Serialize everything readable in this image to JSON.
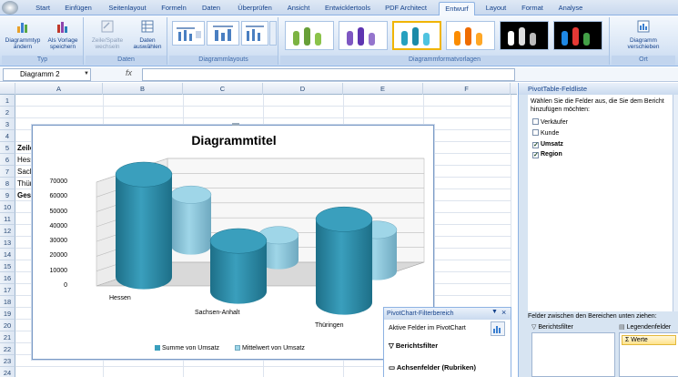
{
  "ribbon": {
    "tabs": [
      "Start",
      "Einfügen",
      "Seitenlayout",
      "Formeln",
      "Daten",
      "Überprüfen",
      "Ansicht",
      "Entwicklertools",
      "PDF Architect",
      "Entwurf",
      "Layout",
      "Format",
      "Analyse"
    ],
    "groups": {
      "typ": {
        "label": "Typ",
        "btn1": [
          "Diagrammtyp",
          "ändern"
        ],
        "btn2": [
          "Als Vorlage",
          "speichern"
        ]
      },
      "daten": {
        "label": "Daten",
        "btn1": [
          "Zeile/Spalte",
          "wechseln"
        ],
        "btn2": [
          "Daten",
          "auswählen"
        ]
      },
      "layouts": {
        "label": "Diagrammlayouts"
      },
      "styles": {
        "label": "Diagrammformatvorlagen"
      },
      "ort": {
        "label": "Ort",
        "btn1": [
          "Diagramm",
          "verschieben"
        ]
      }
    }
  },
  "formula_bar": {
    "name_box": "Diagramm 2",
    "fx": "fx"
  },
  "grid": {
    "columns": [
      "A",
      "B",
      "C",
      "D",
      "E",
      "F"
    ],
    "rows": [
      "1",
      "2",
      "3",
      "4",
      "5",
      "6",
      "7",
      "8",
      "9",
      "10",
      "11",
      "12",
      "13",
      "14",
      "15",
      "16",
      "17",
      "18",
      "19",
      "20",
      "21",
      "22",
      "23",
      "24"
    ],
    "cells": {
      "r5": "Zeile",
      "r6": "Hess",
      "r7": "Sach",
      "r8": "Thür",
      "r9": "Gesa"
    }
  },
  "chart_data": {
    "type": "bar",
    "title": "Diagrammtitel",
    "categories": [
      "Hessen",
      "Sachsen-Anhalt",
      "Thüringen"
    ],
    "series": [
      {
        "name": "Summe von Umsatz",
        "values": [
          69000,
          34000,
          56000
        ],
        "color": "#3a9fbd"
      },
      {
        "name": "Mittelwert von Umsatz",
        "values": [
          34500,
          17000,
          28000
        ],
        "color": "#9fd6e8"
      }
    ],
    "y_ticks": [
      "70000",
      "60000",
      "50000",
      "40000",
      "30000",
      "20000",
      "10000",
      "0"
    ],
    "ylim": [
      0,
      70000
    ],
    "legend": "bottom"
  },
  "pivot_pane": {
    "title": "PivotTable-Feldliste",
    "instruction": "Wählen Sie die Felder aus, die Sie dem Bericht hinzufügen möchten:",
    "fields": [
      {
        "label": "Verkäufer",
        "checked": false
      },
      {
        "label": "Kunde",
        "checked": false
      },
      {
        "label": "Umsatz",
        "checked": true
      },
      {
        "label": "Region",
        "checked": true
      }
    ],
    "areas_label": "Felder zwischen den Bereichen unten ziehen:",
    "berichtsfilter": "Berichtsfilter",
    "legendenfelder": "Legendenfelder",
    "werte": "Werte"
  },
  "filter_pane": {
    "title": "PivotChart-Filterbereich",
    "active": "Aktive Felder im PivotChart",
    "berichtsfilter": "Berichtsfilter",
    "achsenfelder": "Achsenfelder (Rubriken)"
  }
}
